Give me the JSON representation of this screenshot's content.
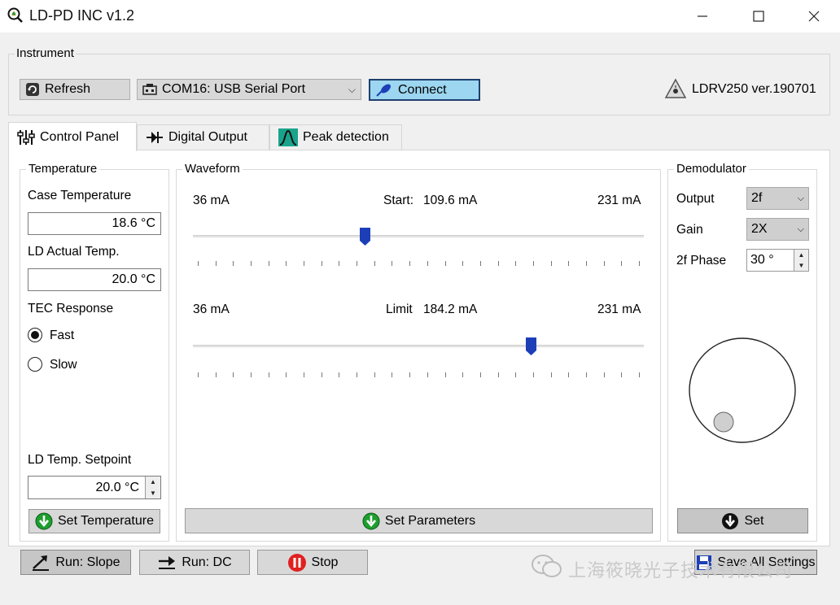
{
  "window": {
    "title": "LD-PD INC v1.2"
  },
  "instrument": {
    "group_title": "Instrument",
    "refresh_label": "Refresh",
    "port_value": "COM16: USB Serial Port",
    "connect_label": "Connect",
    "device_version": "LDRV250 ver.190701"
  },
  "tabs": [
    {
      "label": "Control Panel"
    },
    {
      "label": "Digital Output"
    },
    {
      "label": "Peak detection"
    }
  ],
  "temperature": {
    "group_title": "Temperature",
    "case_label": "Case Temperature",
    "case_value": "18.6 °C",
    "ld_actual_label": "LD Actual Temp.",
    "ld_actual_value": "20.0 °C",
    "tec_label": "TEC Response",
    "fast_label": "Fast",
    "slow_label": "Slow",
    "tec_selected": "Fast",
    "setpoint_label": "LD Temp. Setpoint",
    "setpoint_value": "20.0 °C",
    "set_button": "Set Temperature"
  },
  "waveform": {
    "group_title": "Waveform",
    "start": {
      "min_label": "36 mA",
      "name_label": "Start:",
      "value_label": "109.6 mA",
      "max_label": "231 mA",
      "min": 36,
      "max": 231,
      "value": 109.6
    },
    "limit": {
      "min_label": "36 mA",
      "name_label": "Limit",
      "value_label": "184.2 mA",
      "max_label": "231 mA",
      "min": 36,
      "max": 231,
      "value": 184.2
    },
    "set_button": "Set Parameters"
  },
  "demodulator": {
    "group_title": "Demodulator",
    "output_label": "Output",
    "output_value": "2f",
    "gain_label": "Gain",
    "gain_value": "2X",
    "phase_label": "2f Phase",
    "phase_value": "30 °",
    "set_button": "Set"
  },
  "bottom": {
    "run_slope": "Run: Slope",
    "run_dc": "Run: DC",
    "stop": "Stop",
    "save_settings": "Save All Settings",
    "watermark": "上海筱晓光子技术有限公司"
  },
  "colors": {
    "accent": "#1c3fb8",
    "connect_bg": "#9cd6f0",
    "stop_red": "#e02020",
    "go_green": "#1e9e2e"
  }
}
